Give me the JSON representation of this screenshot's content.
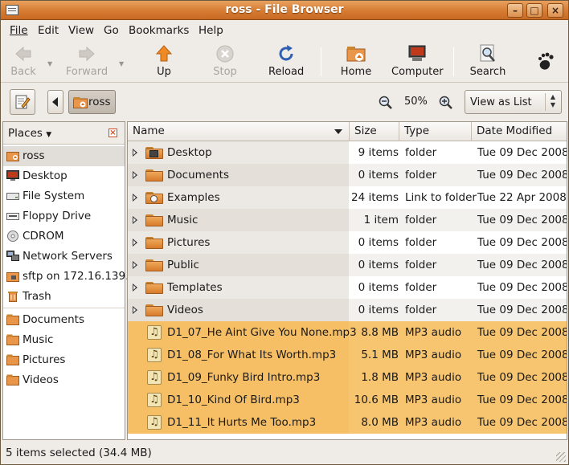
{
  "window": {
    "title": "ross - File Browser"
  },
  "menu": [
    "File",
    "Edit",
    "View",
    "Go",
    "Bookmarks",
    "Help"
  ],
  "toolbar": {
    "back": "Back",
    "forward": "Forward",
    "up": "Up",
    "stop": "Stop",
    "reload": "Reload",
    "home": "Home",
    "computer": "Computer",
    "search": "Search"
  },
  "location": {
    "path_button": "ross",
    "zoom_level": "50%",
    "view_as": "View as List"
  },
  "sidebar": {
    "title": "Places",
    "items": [
      {
        "label": "ross",
        "icon": "home-folder-icon",
        "selected": true
      },
      {
        "label": "Desktop",
        "icon": "desktop-icon"
      },
      {
        "label": "File System",
        "icon": "hard-drive-icon"
      },
      {
        "label": "Floppy Drive",
        "icon": "floppy-icon"
      },
      {
        "label": "CDROM",
        "icon": "cdrom-icon"
      },
      {
        "label": "Network Servers",
        "icon": "network-icon"
      },
      {
        "label": "sftp on 172.16.139.",
        "icon": "remote-folder-icon"
      },
      {
        "label": "Trash",
        "icon": "trash-icon"
      }
    ],
    "bookmarks": [
      {
        "label": "Documents",
        "icon": "folder-icon"
      },
      {
        "label": "Music",
        "icon": "folder-icon"
      },
      {
        "label": "Pictures",
        "icon": "folder-icon"
      },
      {
        "label": "Videos",
        "icon": "folder-icon"
      }
    ]
  },
  "columns": {
    "name": "Name",
    "size": "Size",
    "type": "Type",
    "date": "Date Modified"
  },
  "files": [
    {
      "name": "Desktop",
      "size": "9 items",
      "type": "folder",
      "date": "Tue 09 Dec 2008",
      "kind": "folder",
      "badge": "desk"
    },
    {
      "name": "Documents",
      "size": "0 items",
      "type": "folder",
      "date": "Tue 09 Dec 2008",
      "kind": "folder"
    },
    {
      "name": "Examples",
      "size": "24 items",
      "type": "Link to folder",
      "date": "Tue 22 Apr 2008",
      "kind": "folder",
      "badge": "lock"
    },
    {
      "name": "Music",
      "size": "1 item",
      "type": "folder",
      "date": "Tue 09 Dec 2008",
      "kind": "folder"
    },
    {
      "name": "Pictures",
      "size": "0 items",
      "type": "folder",
      "date": "Tue 09 Dec 2008",
      "kind": "folder"
    },
    {
      "name": "Public",
      "size": "0 items",
      "type": "folder",
      "date": "Tue 09 Dec 2008",
      "kind": "folder"
    },
    {
      "name": "Templates",
      "size": "0 items",
      "type": "folder",
      "date": "Tue 09 Dec 2008",
      "kind": "folder"
    },
    {
      "name": "Videos",
      "size": "0 items",
      "type": "folder",
      "date": "Tue 09 Dec 2008",
      "kind": "folder"
    },
    {
      "name": "D1_07_He Aint Give You None.mp3",
      "size": "8.8 MB",
      "type": "MP3 audio",
      "date": "Tue 09 Dec 2008",
      "kind": "mp3",
      "selected": true
    },
    {
      "name": "D1_08_For What Its Worth.mp3",
      "size": "5.1 MB",
      "type": "MP3 audio",
      "date": "Tue 09 Dec 2008",
      "kind": "mp3",
      "selected": true
    },
    {
      "name": "D1_09_Funky Bird Intro.mp3",
      "size": "1.8 MB",
      "type": "MP3 audio",
      "date": "Tue 09 Dec 2008",
      "kind": "mp3",
      "selected": true
    },
    {
      "name": "D1_10_Kind Of Bird.mp3",
      "size": "10.6 MB",
      "type": "MP3 audio",
      "date": "Tue 09 Dec 2008",
      "kind": "mp3",
      "selected": true
    },
    {
      "name": "D1_11_It Hurts Me Too.mp3",
      "size": "8.0 MB",
      "type": "MP3 audio",
      "date": "Tue 09 Dec 2008",
      "kind": "mp3",
      "selected": true
    }
  ],
  "status": "5 items selected (34.4 MB)",
  "colors": {
    "accent": "#d67b32",
    "selection": "#f7c46f"
  }
}
